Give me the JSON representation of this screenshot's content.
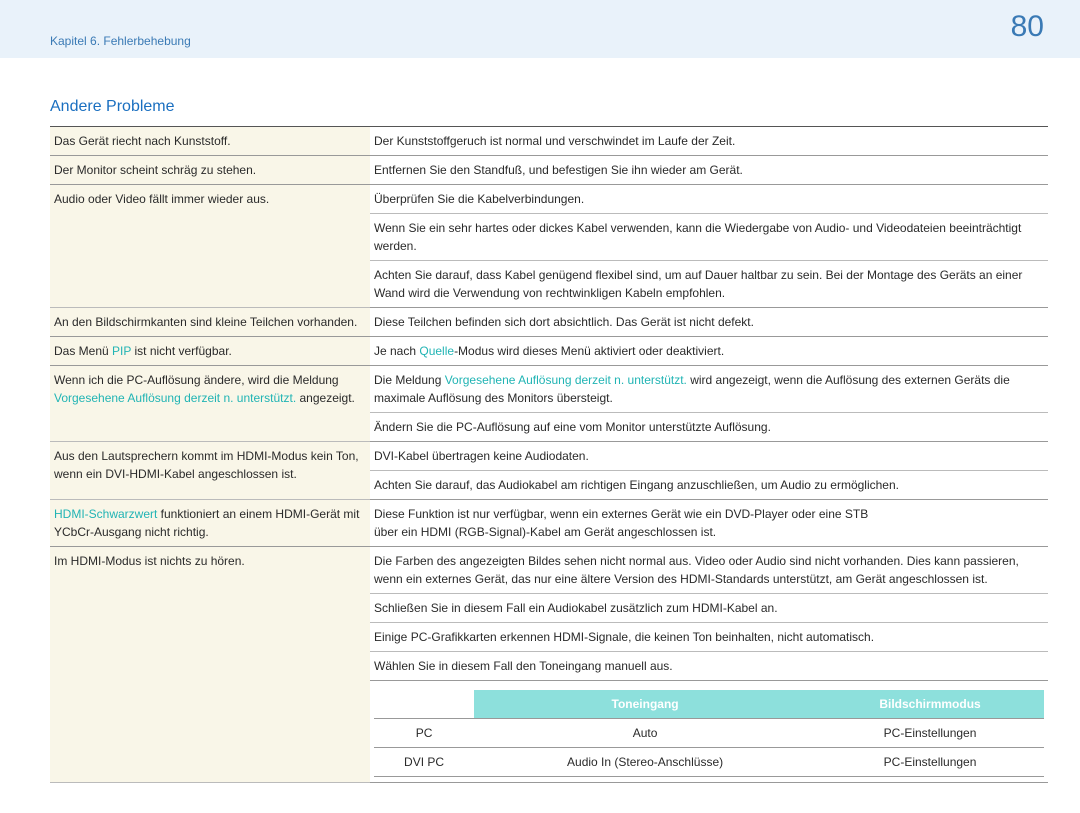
{
  "header": {
    "chapter": "Kapitel 6. Fehlerbehebung",
    "page": "80"
  },
  "section_title": "Andere Probleme",
  "rows": [
    {
      "left": [
        {
          "t": "Das Gerät riecht nach Kunststoff."
        }
      ],
      "right": [
        "Der Kunststoffgeruch ist normal und verschwindet im Laufe der Zeit."
      ]
    },
    {
      "left": [
        {
          "t": "Der Monitor scheint schräg zu stehen."
        }
      ],
      "right": [
        "Entfernen Sie den Standfuß, und befestigen Sie ihn wieder am Gerät."
      ]
    },
    {
      "left": [
        {
          "t": "Audio oder Video fällt immer wieder aus."
        }
      ],
      "right": [
        "Überprüfen Sie die Kabelverbindungen.",
        "Wenn Sie ein sehr hartes oder dickes Kabel verwenden, kann die Wiedergabe von Audio- und Videodateien beeinträchtigt werden.",
        "Achten Sie darauf, dass Kabel genügend flexibel sind, um auf Dauer haltbar zu sein. Bei der Montage des Geräts an einer Wand wird die Verwendung von rechtwinkligen Kabeln empfohlen."
      ]
    },
    {
      "left": [
        {
          "t": "An den Bildschirmkanten sind kleine Teilchen vorhanden."
        }
      ],
      "right": [
        "Diese Teilchen befinden sich dort absichtlich. Das Gerät ist nicht defekt."
      ]
    },
    {
      "left": [
        {
          "t": "Das Menü "
        },
        {
          "t": "PIP",
          "hl": true
        },
        {
          "t": " ist nicht verfügbar."
        }
      ],
      "right_mixed": [
        [
          {
            "t": "Je nach "
          },
          {
            "t": "Quelle",
            "hl": true
          },
          {
            "t": "-Modus wird dieses Menü aktiviert oder deaktiviert."
          }
        ]
      ]
    },
    {
      "left": [
        {
          "t": "Wenn ich die PC-Auflösung ändere, wird die Meldung "
        },
        {
          "t": "Vorgesehene Auflösung derzeit n. unterstützt.",
          "hl": true
        },
        {
          "t": " angezeigt."
        }
      ],
      "right_mixed": [
        [
          {
            "t": "Die Meldung "
          },
          {
            "t": "Vorgesehene Auflösung derzeit n. unterstützt.",
            "hl": true
          },
          {
            "t": " wird angezeigt, wenn die Auflösung des externen Geräts die maximale Auflösung des Monitors übersteigt."
          }
        ],
        [
          {
            "t": "Ändern Sie die PC-Auflösung auf eine vom Monitor unterstützte Auflösung."
          }
        ]
      ]
    },
    {
      "left": [
        {
          "t": "Aus den Lautsprechern kommt im HDMI-Modus kein Ton, wenn ein DVI-HDMI-Kabel angeschlossen ist."
        }
      ],
      "right": [
        "DVI-Kabel übertragen keine Audiodaten.",
        "Achten Sie darauf, das Audiokabel am richtigen Eingang anzuschließen, um Audio zu ermöglichen."
      ]
    },
    {
      "left": [
        {
          "t": "HDMI-Schwarzwert",
          "hl": true
        },
        {
          "t": " funktioniert an einem HDMI-Gerät mit YCbCr-Ausgang nicht richtig."
        }
      ],
      "right": [
        "Diese Funktion ist nur verfügbar, wenn ein externes Gerät wie ein DVD-Player oder eine STB",
        "über ein HDMI (RGB-Signal)-Kabel am Gerät angeschlossen ist."
      ],
      "single_cell": true
    },
    {
      "left": [
        {
          "t": "Im HDMI-Modus ist nichts zu hören."
        }
      ],
      "right": [
        "Die Farben des angezeigten Bildes sehen nicht normal aus. Video oder Audio sind nicht vorhanden. Dies kann passieren, wenn ein externes Gerät, das nur eine ältere Version des HDMI-Standards unterstützt, am Gerät angeschlossen ist.",
        "Schließen Sie in diesem Fall ein Audiokabel zusätzlich zum HDMI-Kabel an.",
        "Einige PC-Grafikkarten erkennen HDMI-Signale, die keinen Ton beinhalten, nicht automatisch.",
        "Wählen Sie in diesem Fall den Toneingang manuell aus."
      ],
      "has_inner_table": true
    }
  ],
  "inner_table": {
    "headers": [
      "",
      "Toneingang",
      "Bildschirmmodus"
    ],
    "rows": [
      [
        "PC",
        "Auto",
        "PC-Einstellungen"
      ],
      [
        "DVI PC",
        "Audio In (Stereo-Anschlüsse)",
        "PC-Einstellungen"
      ]
    ]
  }
}
